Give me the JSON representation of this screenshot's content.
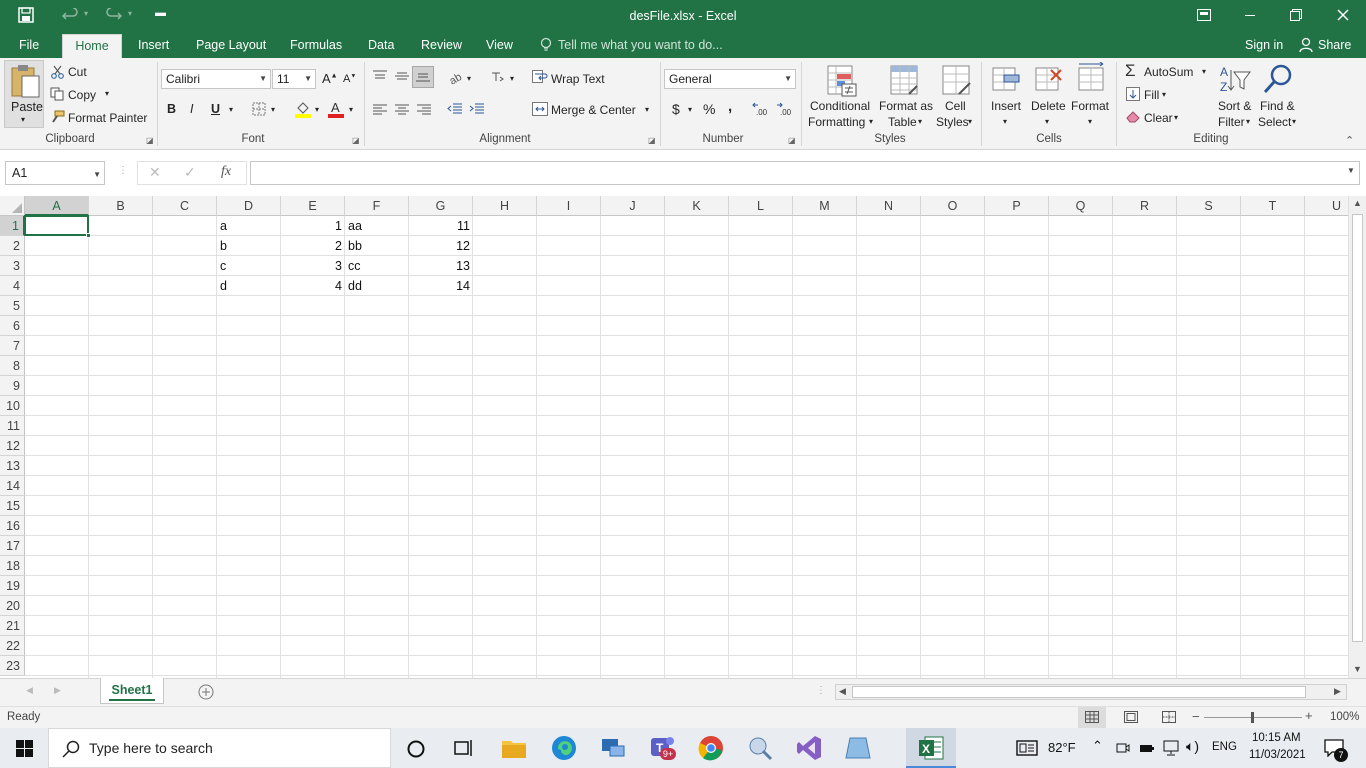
{
  "window": {
    "title": "desFile.xlsx - Excel"
  },
  "tabs": [
    {
      "label": "File"
    },
    {
      "label": "Home"
    },
    {
      "label": "Insert"
    },
    {
      "label": "Page Layout"
    },
    {
      "label": "Formulas"
    },
    {
      "label": "Data"
    },
    {
      "label": "Review"
    },
    {
      "label": "View"
    }
  ],
  "tellme": {
    "placeholder": "Tell me what you want to do..."
  },
  "account": {
    "signin": "Sign in",
    "share": "Share"
  },
  "clipboard": {
    "paste": "Paste",
    "cut": "Cut",
    "copy": "Copy",
    "format_painter": "Format Painter",
    "group": "Clipboard"
  },
  "font": {
    "name": "Calibri",
    "size": "11",
    "bold": "B",
    "italic": "I",
    "underline": "U",
    "group": "Font"
  },
  "alignment": {
    "wrap_text": "Wrap Text",
    "merge_center": "Merge & Center",
    "group": "Alignment"
  },
  "number": {
    "format": "General",
    "currency": "$",
    "percent": "%",
    "comma": ",",
    "group": "Number"
  },
  "styles": {
    "cond_1": "Conditional",
    "cond_2": "Formatting",
    "table_1": "Format as",
    "table_2": "Table",
    "cell_1": "Cell",
    "cell_2": "Styles",
    "group": "Styles"
  },
  "cells": {
    "insert": "Insert",
    "delete": "Delete",
    "format": "Format",
    "group": "Cells"
  },
  "editing": {
    "autosum": "AutoSum",
    "fill": "Fill",
    "clear": "Clear",
    "sort_1": "Sort &",
    "sort_2": "Filter",
    "find_1": "Find &",
    "find_2": "Select",
    "group": "Editing"
  },
  "formula_bar": {
    "name_box": "A1",
    "fx": "fx",
    "value": ""
  },
  "grid": {
    "columns": [
      "A",
      "B",
      "C",
      "D",
      "E",
      "F",
      "G",
      "H",
      "I",
      "J",
      "K",
      "L",
      "M",
      "N",
      "O",
      "P",
      "Q",
      "R",
      "S",
      "T",
      "U"
    ],
    "rows": [
      "1",
      "2",
      "3",
      "4",
      "5",
      "6",
      "7",
      "8",
      "9",
      "10",
      "11",
      "12",
      "13",
      "14",
      "15",
      "16",
      "17",
      "18",
      "19",
      "20",
      "21",
      "22",
      "23"
    ],
    "data": [
      {
        "D": "a",
        "E": "1",
        "F": "aa",
        "G": "11"
      },
      {
        "D": "b",
        "E": "2",
        "F": "bb",
        "G": "12"
      },
      {
        "D": "c",
        "E": "3",
        "F": "cc",
        "G": "13"
      },
      {
        "D": "d",
        "E": "4",
        "F": "dd",
        "G": "14"
      }
    ]
  },
  "sheets": [
    {
      "name": "Sheet1"
    }
  ],
  "status": {
    "mode": "Ready",
    "zoom": "100%"
  },
  "taskbar": {
    "search_placeholder": "Type here to search",
    "teams_badge": "9+",
    "temperature": "82°F",
    "language": "ENG",
    "time": "10:15 AM",
    "date": "11/03/2021",
    "notifications": "7"
  }
}
